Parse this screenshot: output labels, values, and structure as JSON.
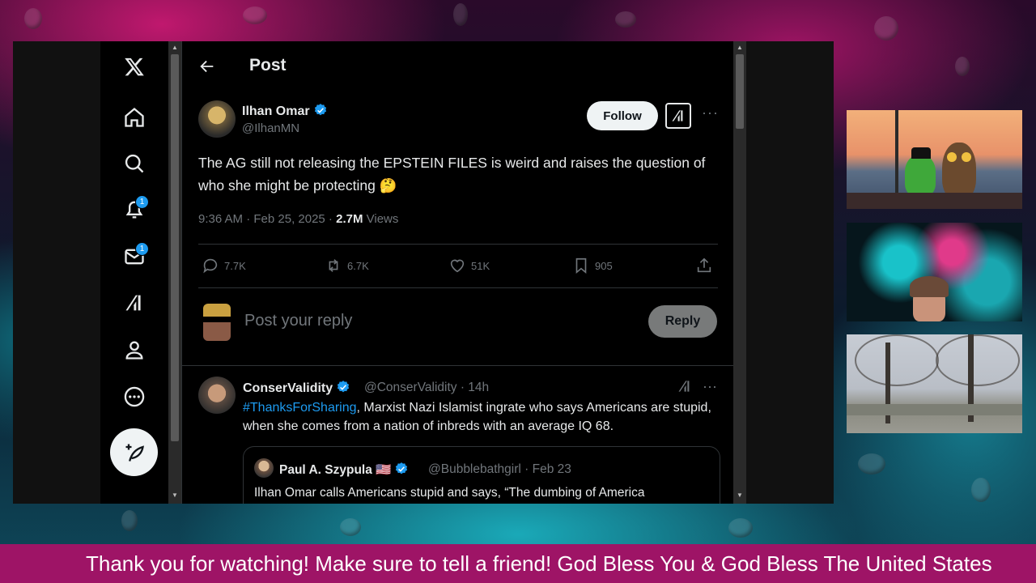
{
  "sidebar": {
    "items": [
      {
        "name": "x-logo-icon"
      },
      {
        "name": "home-icon"
      },
      {
        "name": "search-icon"
      },
      {
        "name": "notifications-icon",
        "badge": "1"
      },
      {
        "name": "messages-icon",
        "badge": "1"
      },
      {
        "name": "grok-icon"
      },
      {
        "name": "profile-icon"
      },
      {
        "name": "more-icon"
      },
      {
        "name": "compose-post-icon"
      }
    ]
  },
  "header": {
    "title": "Post"
  },
  "post": {
    "author_name": "Ilhan Omar",
    "author_handle": "@IlhanMN",
    "follow_label": "Follow",
    "text": "The AG still not releasing the EPSTEIN FILES is weird and raises the question of who she might be protecting 🤔",
    "time": "9:36 AM · Feb 25, 2025 · ",
    "views_count": "2.7M",
    "views_label": " Views",
    "replies": "7.7K",
    "reposts": "6.7K",
    "likes": "51K",
    "bookmarks": "905"
  },
  "reply_box": {
    "placeholder": "Post your reply",
    "button": "Reply"
  },
  "comment": {
    "name": "ConserValidity",
    "handle": "@ConserValidity · 14h",
    "hashtag": "#ThanksForSharing",
    "text": ", Marxist Nazi Islamist ingrate who says Americans are stupid, when she comes from a nation of inbreds with an average IQ 68.",
    "quote": {
      "name": "Paul A. Szypula 🇺🇸",
      "handle": "@Bubblebathgirl · Feb 23",
      "text": "Ilhan Omar calls Americans stupid and says, “The dumbing of America"
    }
  },
  "ticker": {
    "text": "Thank you for watching! Make sure to tell a friend! God Bless You & God Bless The United States"
  },
  "colors": {
    "accent": "#1d9bf0",
    "ticker_bg": "#9e1466",
    "post_bg": "#000000"
  }
}
